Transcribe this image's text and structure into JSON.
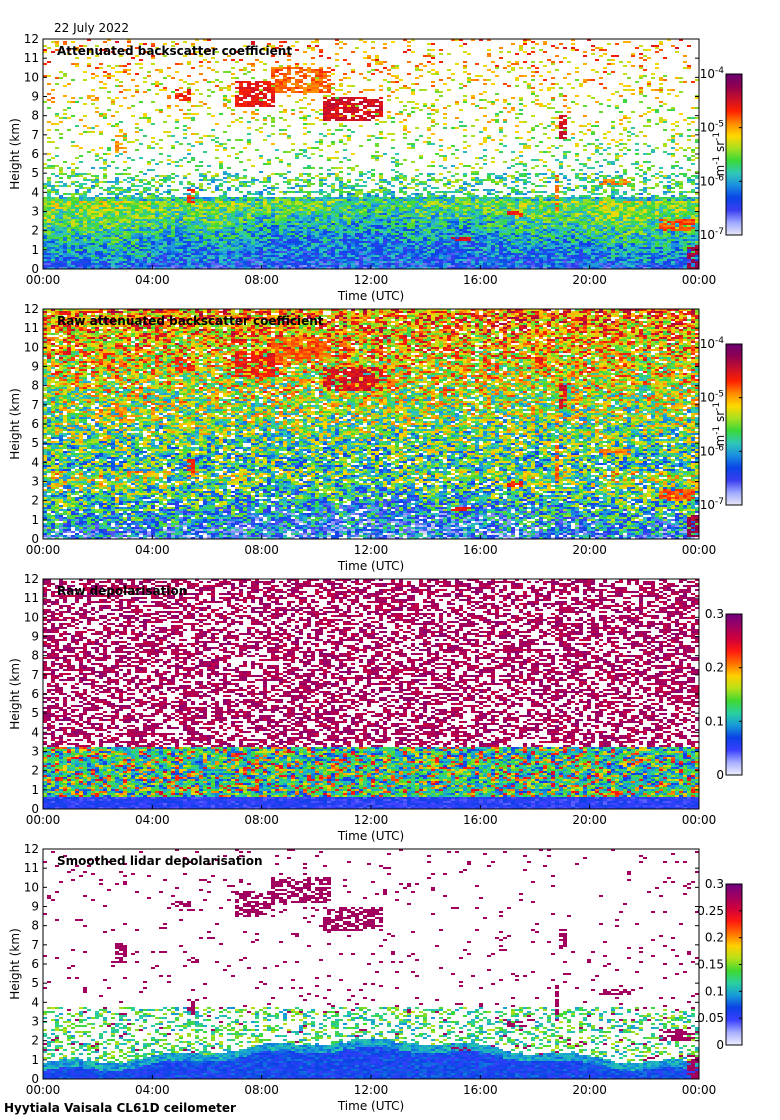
{
  "date": "22 July 2022",
  "footer": "Hyytiala Vaisala CL61D ceilometer",
  "colormaps": {
    "backscatter": [
      "#e8e8f6",
      "#9ea8ff",
      "#3a3ef0",
      "#0a44e8",
      "#1a8fe0",
      "#30c8b8",
      "#3ad838",
      "#a8e020",
      "#ffd800",
      "#ff8a00",
      "#ff2000",
      "#c8102a",
      "#900050",
      "#6a0070"
    ],
    "depol": [
      "#f0f0ff",
      "#a8b0ff",
      "#3b40ff",
      "#0b40e6",
      "#169ad8",
      "#2ad0a0",
      "#40d830",
      "#b8e018",
      "#ffd000",
      "#ff7000",
      "#ff1a10",
      "#d0003a",
      "#a00060",
      "#700080"
    ]
  },
  "chart_data": [
    {
      "type": "heatmap",
      "title": "Attenuated backscatter coefficient",
      "xlabel": "Time (UTC)",
      "ylabel": "Height (km)",
      "x_ticks": [
        "00:00",
        "04:00",
        "08:00",
        "12:00",
        "16:00",
        "20:00",
        "00:00"
      ],
      "y_ticks": [
        "0",
        "1",
        "2",
        "3",
        "4",
        "5",
        "6",
        "7",
        "8",
        "9",
        "10",
        "11",
        "12"
      ],
      "xlim": [
        0,
        24
      ],
      "ylim": [
        0,
        12
      ],
      "colorbar": {
        "scale": "log",
        "range": [
          1e-07,
          0.0001
        ],
        "ticks": [
          {
            "base": "10",
            "exp": "-4"
          },
          {
            "base": "10",
            "exp": "-5"
          },
          {
            "base": "10",
            "exp": "-6"
          },
          {
            "base": "10",
            "exp": "-7"
          }
        ],
        "unit": {
          "a": "m",
          "a_exp": "-1",
          "b": " sr",
          "b_exp": "-1"
        }
      },
      "colormap": "backscatter",
      "mode": "bs",
      "noise": 0.28
    },
    {
      "type": "heatmap",
      "title": "Raw attenuated backscatter coefficient",
      "xlabel": "Time (UTC)",
      "ylabel": "Height (km)",
      "x_ticks": [
        "00:00",
        "04:00",
        "08:00",
        "12:00",
        "16:00",
        "20:00",
        "00:00"
      ],
      "y_ticks": [
        "0",
        "1",
        "2",
        "3",
        "4",
        "5",
        "6",
        "7",
        "8",
        "9",
        "10",
        "11",
        "12"
      ],
      "xlim": [
        0,
        24
      ],
      "ylim": [
        0,
        12
      ],
      "colorbar": {
        "scale": "log",
        "range": [
          1e-07,
          0.0001
        ],
        "ticks": [
          {
            "base": "10",
            "exp": "-4"
          },
          {
            "base": "10",
            "exp": "-5"
          },
          {
            "base": "10",
            "exp": "-6"
          },
          {
            "base": "10",
            "exp": "-7"
          }
        ],
        "unit": {
          "a": "m",
          "a_exp": "-1",
          "b": " sr",
          "b_exp": "-1"
        }
      },
      "colormap": "backscatter",
      "mode": "rawbs",
      "noise": 1.0
    },
    {
      "type": "heatmap",
      "title": "Raw depolarisation",
      "xlabel": "Time (UTC)",
      "ylabel": "Height (km)",
      "x_ticks": [
        "00:00",
        "04:00",
        "08:00",
        "12:00",
        "16:00",
        "20:00",
        "00:00"
      ],
      "y_ticks": [
        "0",
        "1",
        "2",
        "3",
        "4",
        "5",
        "6",
        "7",
        "8",
        "9",
        "10",
        "11",
        "12"
      ],
      "xlim": [
        0,
        24
      ],
      "ylim": [
        0,
        12
      ],
      "colorbar": {
        "scale": "linear",
        "range": [
          0,
          0.3
        ],
        "ticks": [
          {
            "label": "0.3",
            "value": 0.3
          },
          {
            "label": "0.2",
            "value": 0.2
          },
          {
            "label": "0.1",
            "value": 0.1
          },
          {
            "label": "0",
            "value": 0
          }
        ]
      },
      "colormap": "depol",
      "mode": "rawdep",
      "noise": 1.0
    },
    {
      "type": "heatmap",
      "title": "Smoothed lidar depolarisation",
      "xlabel": "Time (UTC)",
      "ylabel": "Height (km)",
      "x_ticks": [
        "00:00",
        "04:00",
        "08:00",
        "12:00",
        "16:00",
        "20:00",
        "00:00"
      ],
      "y_ticks": [
        "0",
        "1",
        "2",
        "3",
        "4",
        "5",
        "6",
        "7",
        "8",
        "9",
        "10",
        "11",
        "12"
      ],
      "xlim": [
        0,
        24
      ],
      "ylim": [
        0,
        12
      ],
      "colorbar": {
        "scale": "linear",
        "range": [
          0,
          0.3
        ],
        "ticks": [
          {
            "label": "0.3",
            "value": 0.3
          },
          {
            "label": "0.25",
            "value": 0.25
          },
          {
            "label": "0.2",
            "value": 0.2
          },
          {
            "label": "0.15",
            "value": 0.15
          },
          {
            "label": "0.1",
            "value": 0.1
          },
          {
            "label": "0.05",
            "value": 0.05
          },
          {
            "label": "0",
            "value": 0
          }
        ]
      },
      "colormap": "depol",
      "mode": "smdep",
      "noise": 0.12
    }
  ]
}
